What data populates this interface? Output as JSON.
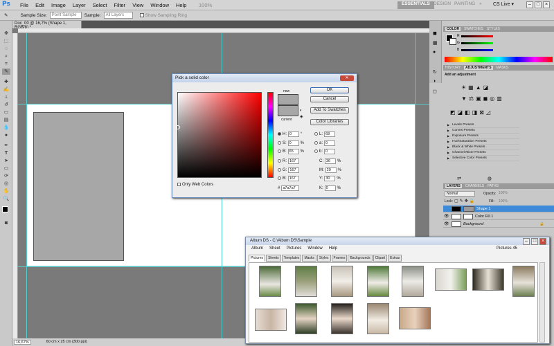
{
  "app": {
    "logo": "Ps",
    "menus": [
      "File",
      "Edit",
      "Image",
      "Layer",
      "Select",
      "Filter",
      "View",
      "Window",
      "Help"
    ],
    "zoom": "100%",
    "workspaces": [
      "ESSENTIALS",
      "DESIGN",
      "PAINTING",
      "»"
    ],
    "cslive": "CS Live ▾"
  },
  "options": {
    "sample_size_label": "Sample Size:",
    "sample_size_value": "Point Sample",
    "sample_label": "Sample:",
    "sample_value": "All Layers",
    "show_ring": "Show Sampling Ring"
  },
  "document": {
    "tab": "Doc_00 @ 16,7% (Shape 1, RGB/8) *",
    "zoom": "16,67%",
    "size": "60 cm x 25 cm (300 ppi)"
  },
  "picker": {
    "title": "Pick a solid color",
    "new_label": "new",
    "current_label": "current",
    "new_color": "#a7a7a7",
    "current_color": "#a7a7a7",
    "ok": "OK",
    "cancel": "Cancel",
    "add_swatches": "Add To Swatches",
    "color_libraries": "Color Libraries",
    "only_web": "Only Web Colors",
    "fields": {
      "H": "0",
      "S": "0",
      "Bv": "65",
      "R": "167",
      "G": "167",
      "B": "167",
      "L": "68",
      "a": "0",
      "b": "0",
      "C": "36",
      "M": "29",
      "Y": "30",
      "K": "0",
      "hex": "a7a7a7"
    },
    "units": {
      "deg": "°",
      "pct": "%"
    }
  },
  "panels": {
    "color_tabs": [
      "COLOR",
      "SWATCHES",
      "STYLES"
    ],
    "adj_tabs": [
      "HISTORY",
      "ADJUSTMENTS",
      "MASKS"
    ],
    "add_adjustment": "Add an adjustment",
    "presets": [
      "Levels Presets",
      "Curves Presets",
      "Exposure Presets",
      "Hue/Saturation Presets",
      "Black & White Presets",
      "Channel Mixer Presets",
      "Selective Color Presets"
    ],
    "layer_tabs": [
      "LAYERS",
      "CHANNELS",
      "PATHS"
    ],
    "blend_mode": "Normal",
    "opacity_label": "Opacity:",
    "opacity": "100%",
    "lock_label": "Lock:",
    "fill_label": "Fill:",
    "fill": "100%",
    "layers": [
      "Shape 1",
      "Color Fill 1",
      "Background"
    ]
  },
  "album": {
    "title": "Album DS  -  C:\\Album DS\\Sample",
    "menus": [
      "Album",
      "Sheet",
      "Pictures",
      "Window",
      "Help"
    ],
    "count": "Pictures  45",
    "tabs": [
      "Pictures",
      "Sheets",
      "Templates",
      "Masks",
      "Styles",
      "Frames",
      "Backgrounds",
      "Clipart",
      "Extras"
    ]
  }
}
